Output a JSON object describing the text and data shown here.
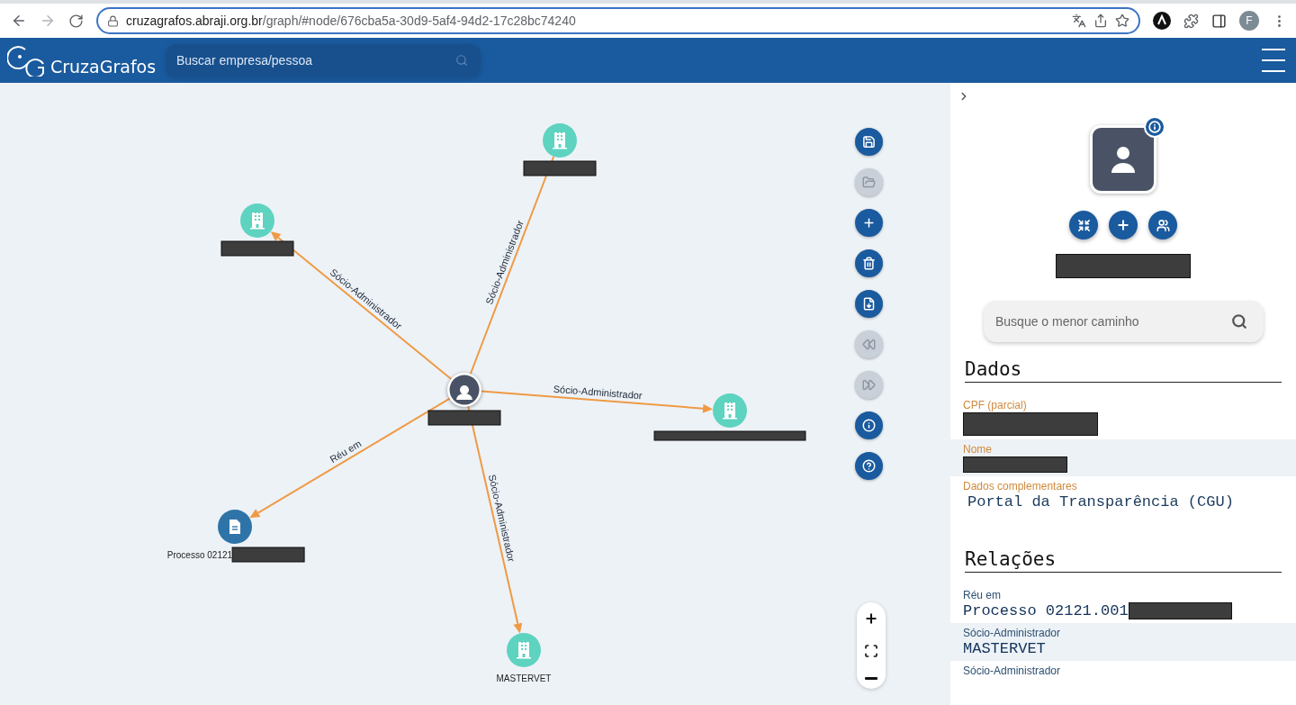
{
  "browser": {
    "url_host": "cruzagrafos.abraji.org.br",
    "url_path": "/graph/#node/676cba5a-30d9-5af4-94d2-17c28bc74240",
    "forward_disabled": true,
    "profile_initial": "F"
  },
  "header": {
    "logo": "CruzaGrafos",
    "search": {
      "placeholder": "Buscar empresa/pessoa"
    }
  },
  "graph": {
    "nodes": [
      {
        "kind": "person",
        "redacted": true
      },
      {
        "kind": "company",
        "redacted": true
      },
      {
        "kind": "company",
        "redacted": true
      },
      {
        "kind": "company",
        "redacted": true
      },
      {
        "kind": "document",
        "label": "Processo 02121",
        "redacted": true
      },
      {
        "kind": "company",
        "label": "MASTERVET"
      }
    ],
    "edges": [
      {
        "label": "Sócio-Administrador",
        "arrow": false
      },
      {
        "label": "Sócio-Administrador",
        "arrow": true
      },
      {
        "label": "Sócio-Administrador",
        "arrow": true
      },
      {
        "label": "Réu em",
        "arrow": true
      },
      {
        "label": "Sócio-Administrador",
        "arrow": true
      }
    ]
  },
  "toolbar": [
    {
      "kind": "save",
      "disabled": false
    },
    {
      "kind": "open",
      "disabled": true
    },
    {
      "kind": "add",
      "disabled": false
    },
    {
      "kind": "delete",
      "disabled": false
    },
    {
      "kind": "export",
      "disabled": false
    },
    {
      "kind": "undo",
      "disabled": true
    },
    {
      "kind": "redo",
      "disabled": true
    },
    {
      "kind": "info",
      "disabled": false
    },
    {
      "kind": "help",
      "disabled": false
    }
  ],
  "panel": {
    "name_redacted": true,
    "path_search": {
      "placeholder": "Busque o menor caminho"
    },
    "data_title": "Dados",
    "data_fields": [
      {
        "label": "CPF (parcial)",
        "redacted": true
      },
      {
        "label": "Nome",
        "redacted": true
      },
      {
        "label": "Dados complementares",
        "value": "Portal da Transparência (CGU)"
      }
    ],
    "relations_title": "Relações",
    "relations": [
      {
        "type": "Réu em",
        "target": "Processo 02121.001",
        "redacted": true
      },
      {
        "type": "Sócio-Administrador",
        "target": "MASTERVET"
      },
      {
        "type": "Sócio-Administrador"
      }
    ]
  }
}
